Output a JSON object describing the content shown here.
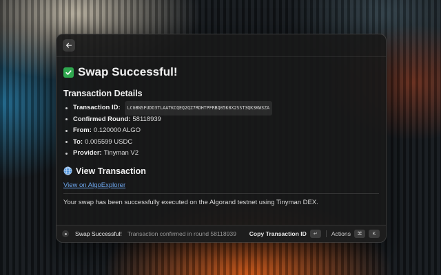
{
  "header": {
    "title": "Swap Successful!"
  },
  "details": {
    "heading": "Transaction Details",
    "items": [
      {
        "label": "Transaction ID:",
        "value": "LCGBNSFUDO3TLAATKCQEQ2QZ7RDHTPFRBQ05K0X2SST3QK3KW3ZA",
        "mono": true
      },
      {
        "label": "Confirmed Round:",
        "value": "58118939"
      },
      {
        "label": "From:",
        "value": "0.120000 ALGO"
      },
      {
        "label": "To:",
        "value": "0.005599 USDC"
      },
      {
        "label": "Provider:",
        "value": "Tinyman V2"
      }
    ]
  },
  "view": {
    "heading": "View Transaction",
    "link_text": "View on AlgoExplorer"
  },
  "message": "Your swap has been successfully executed on the Algorand testnet using Tinyman DEX.",
  "footer": {
    "title": "Swap Successful!",
    "subtitle": "Transaction confirmed in round 58118939",
    "primary_action": "Copy Transaction ID",
    "primary_key": "↵",
    "actions_label": "Actions",
    "actions_keys": [
      "⌘",
      "K"
    ]
  },
  "colors": {
    "accent_link": "#6ea8f0",
    "success": "#2fa84f"
  },
  "icons": {
    "back": "arrow-left-icon",
    "success": "check-mark-button-icon",
    "globe": "globe-icon",
    "status": "status-dot-icon"
  }
}
